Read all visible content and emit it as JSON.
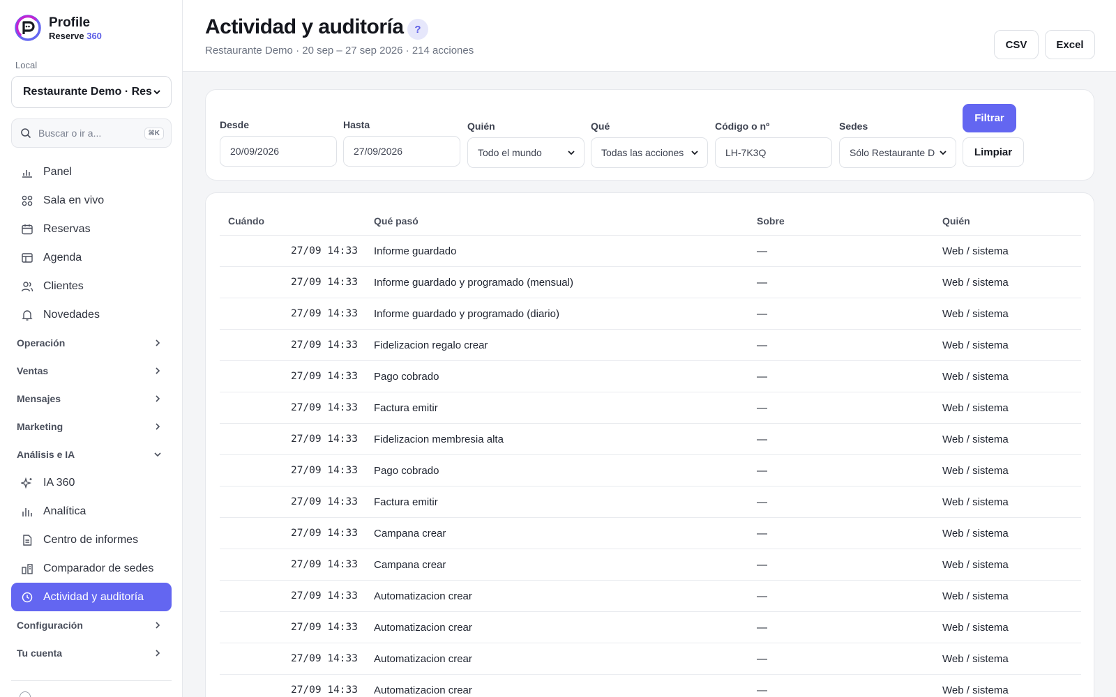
{
  "brand": {
    "name": "Profile",
    "sub_main": "Reserve ",
    "sub_accent": "360",
    "accent_color": "#5b5ce6"
  },
  "sidebar": {
    "local_label": "Local",
    "local_value": "Restaurante Demo · Res",
    "search_placeholder": "Buscar o ir a...",
    "search_shortcut": "⌘K",
    "items_top": [
      {
        "label": "Panel",
        "icon": "bar-chart-icon"
      },
      {
        "label": "Sala en vivo",
        "icon": "grid-icon"
      },
      {
        "label": "Reservas",
        "icon": "calendar-icon"
      },
      {
        "label": "Agenda",
        "icon": "table-icon"
      },
      {
        "label": "Clientes",
        "icon": "users-icon"
      },
      {
        "label": "Novedades",
        "icon": "bell-icon"
      }
    ],
    "groups_closed": [
      "Operación",
      "Ventas",
      "Mensajes",
      "Marketing"
    ],
    "group_open": "Análisis e IA",
    "group_items": [
      {
        "label": "IA 360",
        "icon": "sparkle-icon"
      },
      {
        "label": "Analítica",
        "icon": "analytics-icon"
      },
      {
        "label": "Centro de informes",
        "icon": "document-icon"
      },
      {
        "label": "Comparador de sedes",
        "icon": "compare-icon"
      },
      {
        "label": "Actividad y auditoría",
        "icon": "clock-icon",
        "active": true
      }
    ],
    "groups_bottom": [
      "Configuración",
      "Tu cuenta"
    ],
    "active_color": "#6366f1"
  },
  "header": {
    "title": "Actividad y auditoría",
    "help": "?",
    "subtitle": "Restaurante Demo · 20 sep – 27 sep 2026 · 214 acciones",
    "csv_label": "CSV",
    "excel_label": "Excel"
  },
  "filters": {
    "desde_label": "Desde",
    "desde_value": "20/09/2026",
    "hasta_label": "Hasta",
    "hasta_value": "27/09/2026",
    "quien_label": "Quién",
    "quien_value": "Todo el mundo",
    "que_label": "Qué",
    "que_value": "Todas las acciones",
    "codigo_label": "Código o nº",
    "codigo_value": "LH-7K3Q",
    "sedes_label": "Sedes",
    "sedes_value": "Sólo Restaurante D",
    "filtrar_label": "Filtrar",
    "limpiar_label": "Limpiar"
  },
  "table": {
    "headers": {
      "when": "Cuándo",
      "what": "Qué pasó",
      "about": "Sobre",
      "who": "Quién"
    },
    "rows": [
      {
        "when": "27/09 14:33",
        "what": "Informe guardado",
        "about": "—",
        "who": "Web / sistema"
      },
      {
        "when": "27/09 14:33",
        "what": "Informe guardado y programado (mensual)",
        "about": "—",
        "who": "Web / sistema"
      },
      {
        "when": "27/09 14:33",
        "what": "Informe guardado y programado (diario)",
        "about": "—",
        "who": "Web / sistema"
      },
      {
        "when": "27/09 14:33",
        "what": "Fidelizacion regalo crear",
        "about": "—",
        "who": "Web / sistema"
      },
      {
        "when": "27/09 14:33",
        "what": "Pago cobrado",
        "about": "—",
        "who": "Web / sistema"
      },
      {
        "when": "27/09 14:33",
        "what": "Factura emitir",
        "about": "—",
        "who": "Web / sistema"
      },
      {
        "when": "27/09 14:33",
        "what": "Fidelizacion membresia alta",
        "about": "—",
        "who": "Web / sistema"
      },
      {
        "when": "27/09 14:33",
        "what": "Pago cobrado",
        "about": "—",
        "who": "Web / sistema"
      },
      {
        "when": "27/09 14:33",
        "what": "Factura emitir",
        "about": "—",
        "who": "Web / sistema"
      },
      {
        "when": "27/09 14:33",
        "what": "Campana crear",
        "about": "—",
        "who": "Web / sistema"
      },
      {
        "when": "27/09 14:33",
        "what": "Campana crear",
        "about": "—",
        "who": "Web / sistema"
      },
      {
        "when": "27/09 14:33",
        "what": "Automatizacion crear",
        "about": "—",
        "who": "Web / sistema"
      },
      {
        "when": "27/09 14:33",
        "what": "Automatizacion crear",
        "about": "—",
        "who": "Web / sistema"
      },
      {
        "when": "27/09 14:33",
        "what": "Automatizacion crear",
        "about": "—",
        "who": "Web / sistema"
      },
      {
        "when": "27/09 14:33",
        "what": "Automatizacion crear",
        "about": "—",
        "who": "Web / sistema"
      }
    ]
  }
}
